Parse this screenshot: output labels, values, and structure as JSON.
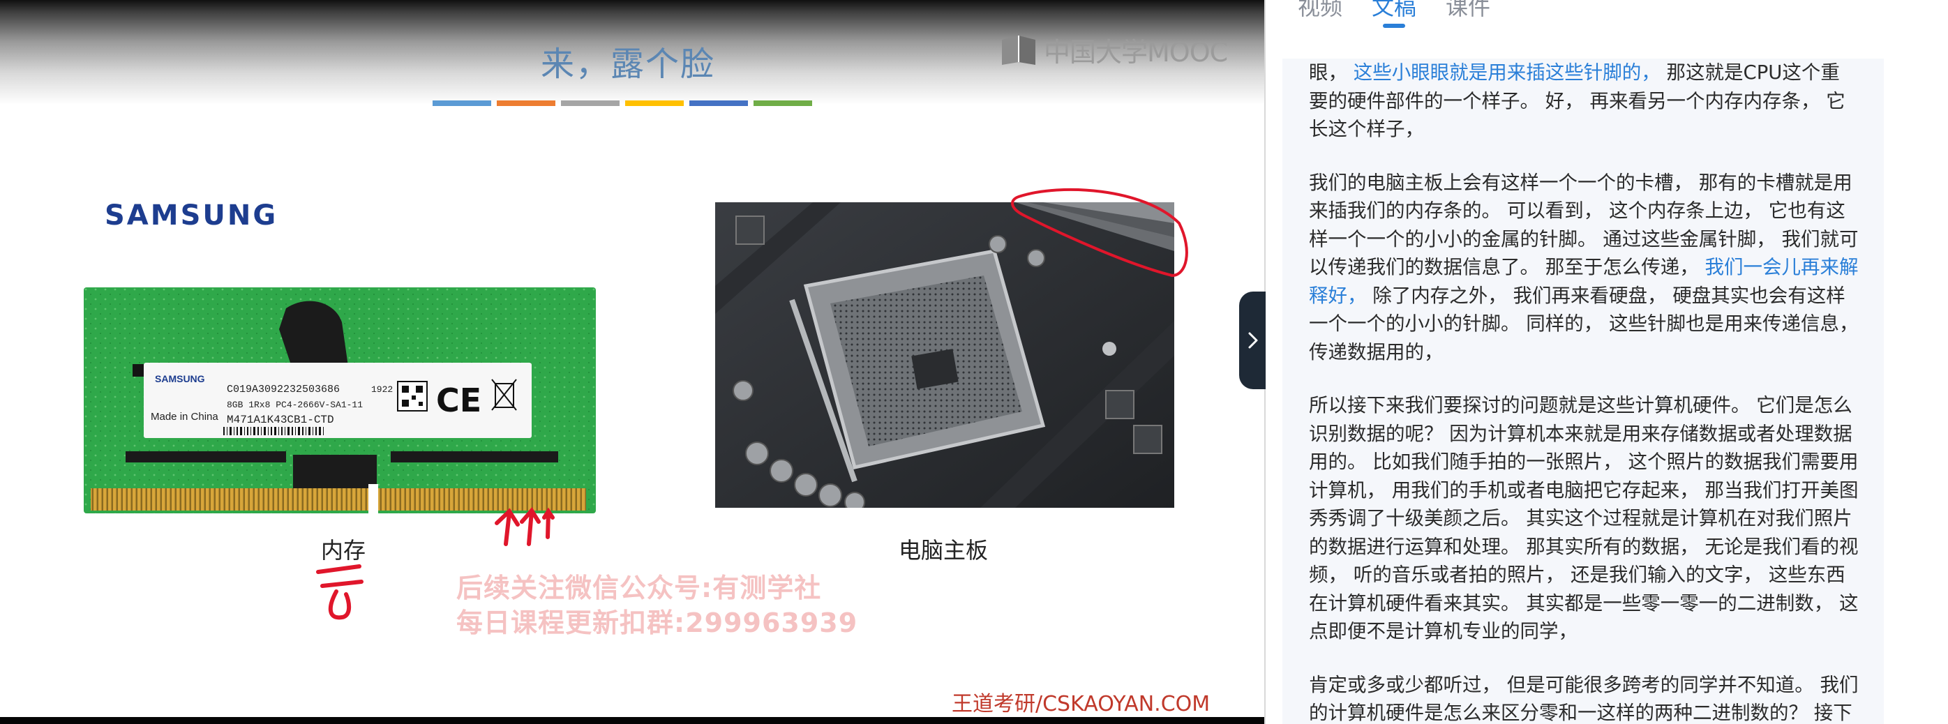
{
  "slide": {
    "title": "来，露个脸",
    "strip_colors": [
      "#5b9bd5",
      "#ed7d31",
      "#a5a5a5",
      "#ffc000",
      "#4472c4",
      "#70ad47"
    ],
    "mooc_logo": "中国大学MOOC",
    "samsung_logo": "SAMSUNG",
    "ram_label": {
      "brand": "SAMSUNG",
      "code": "C019A3092232503686",
      "spec": "8GB 1Rx8 PC4-2666V-SA1-11",
      "origin": "Made in China",
      "part": "M471A1K43CB1-CTD",
      "year": "1922"
    },
    "caption_ram": "内存",
    "caption_motherboard": "电脑主板",
    "watermark_line1": "后续关注微信公众号:有测学社",
    "watermark_line2": "每日课程更新扣群:299963939",
    "footer_brand": "王道考研/CSKAOYAN.COM",
    "annotation_color": "#e0162b"
  },
  "panel": {
    "tabs": [
      {
        "label": "视频",
        "active": false
      },
      {
        "label": "文稿",
        "active": true
      },
      {
        "label": "课件",
        "active": false
      }
    ],
    "accent_color": "#2a7fd8",
    "transcript": {
      "p1": {
        "a": "眼， ",
        "hl": "这些小眼眼就是用来插这些针脚的，",
        "b": " 那这就是CPU这个重要的硬件部件的一个样子。 好， 再来看另一个内存内存条， 它长这个样子，"
      },
      "p2": {
        "a": "我们的电脑主板上会有这样一个一个的卡槽， 那有的卡槽就是用来插我们的内存条的。 可以看到， 这个内存条上边， 它也有这样一个一个的小小的金属的针脚。 通过这些金属针脚， 我们就可以传递我们的数据信息了。 那至于怎么传递， ",
        "hl": "我们一会儿再来解释好，",
        "b": " 除了内存之外， 我们再来看硬盘， 硬盘其实也会有这样一个一个的小小的针脚。 同样的， 这些针脚也是用来传递信息， 传递数据用的，"
      },
      "p3": "所以接下来我们要探讨的问题就是这些计算机硬件。 它们是怎么识别数据的呢？ 因为计算机本来就是用来存储数据或者处理数据用的。 比如我们随手拍的一张照片， 这个照片的数据我们需要用计算机， 用我们的手机或者电脑把它存起来， 那当我们打开美图秀秀调了十级美颜之后。 其实这个过程就是计算机在对我们照片的数据进行运算和处理。 那其实所有的数据， 无论是我们看的视频， 听的音乐或者拍的照片， 还是我们输入的文字， 这些东西在计算机硬件看来其实。 其实都是一些零一零一的二进制数， 这点即便不是计算机专业的同学，",
      "p4": "肯定或多或少都听过， 但是可能很多跨考的同学并不知道。 我们的计算机硬件是怎么来区分零和一这样的两种二进制数的？ 接下来我们就来一起探讨这个问题，"
    }
  }
}
